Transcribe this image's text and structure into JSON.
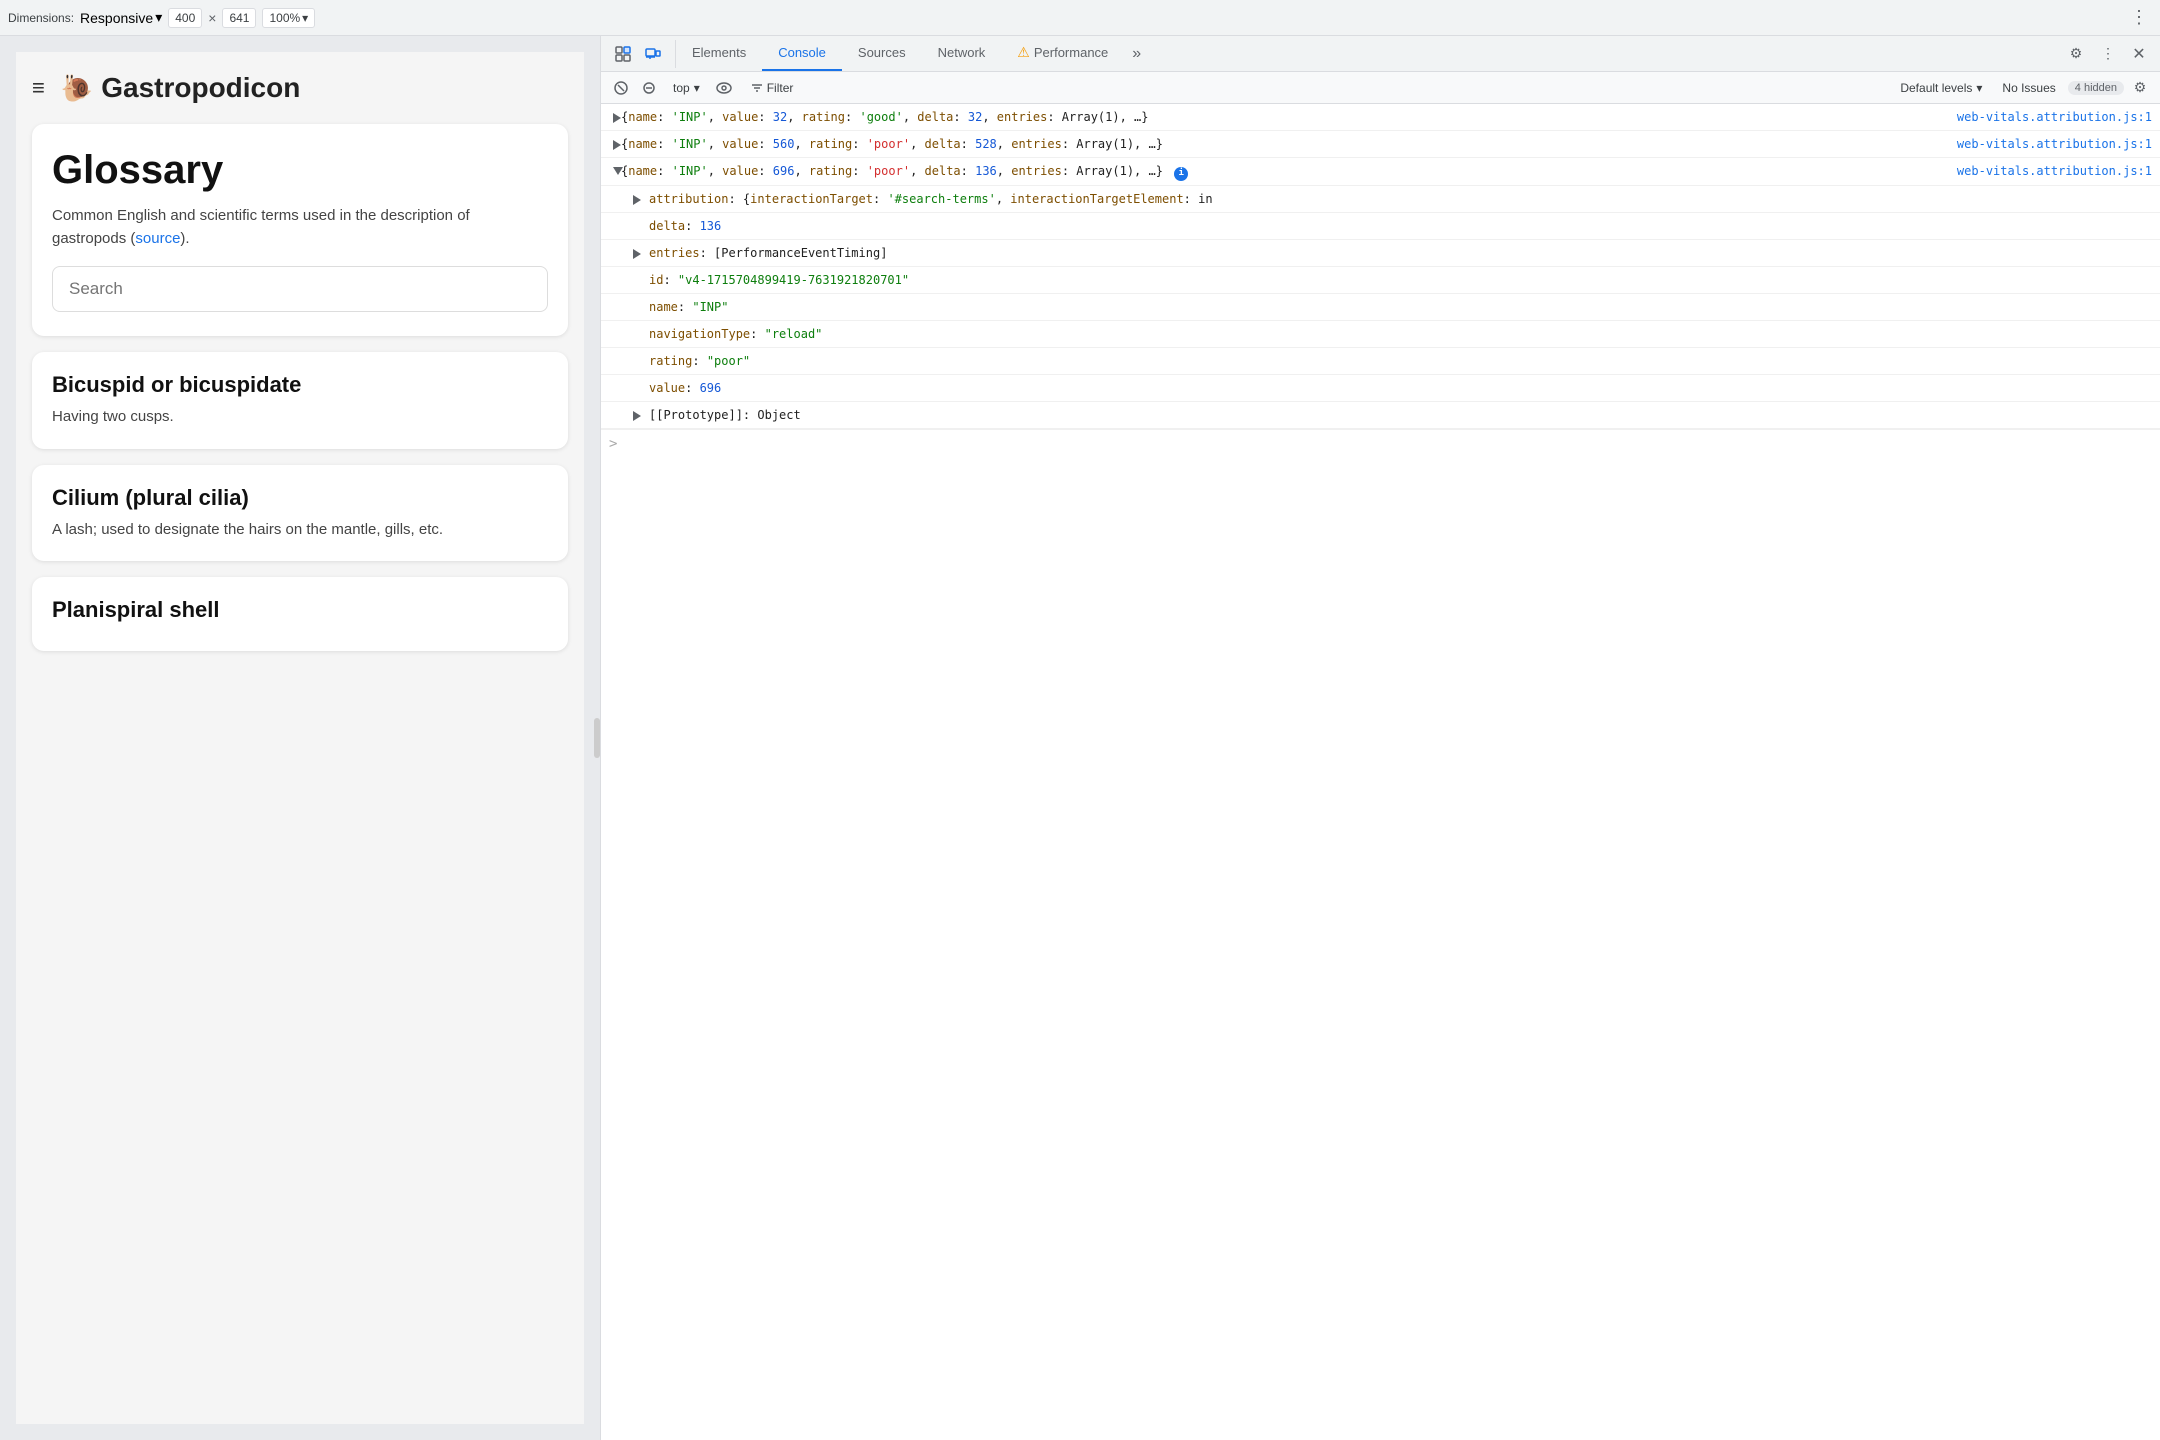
{
  "topToolbar": {
    "dimensionsLabel": "Dimensions:",
    "dimensionsType": "Responsive",
    "width": "400",
    "x": "×",
    "height": "641",
    "zoom": "100%",
    "zoomChevron": "▾",
    "typeChevron": "▾"
  },
  "webpage": {
    "hamburger": "≡",
    "logoEmoji": "🐌",
    "logoText": "Gastropodicon",
    "glossaryTitle": "Glossary",
    "glossaryDesc": "Common English and scientific terms used in the description of gastropods (",
    "sourceLink": "source",
    "glossaryDescEnd": ").",
    "searchPlaceholder": "Search",
    "terms": [
      {
        "title": "Bicuspid or bicuspidate",
        "desc": "Having two cusps."
      },
      {
        "title": "Cilium (plural cilia)",
        "desc": "A lash; used to designate the hairs on the mantle, gills, etc."
      },
      {
        "title": "Planispiral shell",
        "desc": ""
      }
    ]
  },
  "devtools": {
    "tabs": [
      {
        "id": "elements",
        "label": "Elements"
      },
      {
        "id": "console",
        "label": "Console"
      },
      {
        "id": "sources",
        "label": "Sources"
      },
      {
        "id": "network",
        "label": "Network"
      },
      {
        "id": "performance",
        "label": "Performance"
      }
    ],
    "activeTab": "console",
    "contextSelector": "top",
    "filterLabel": "Filter",
    "defaultLevels": "Default levels",
    "defaultLevelsChevron": "▾",
    "noIssues": "No Issues",
    "hiddenCount": "4 hidden",
    "consoleLines": [
      {
        "type": "collapsed",
        "link": "web-vitals.attribution.js:1",
        "text": "{name: 'INP', value: 32, rating: 'good', delta: 32, entries: Array(1), …}"
      },
      {
        "type": "collapsed",
        "link": "web-vitals.attribution.js:1",
        "text": "{name: 'INP', value: 560, rating: 'poor', delta: 528, entries: Array(1), …}"
      },
      {
        "type": "expanded",
        "link": "web-vitals.attribution.js:1",
        "text": "{name: 'INP', value: 696, rating: 'poor', delta: 136, entries: Array(1), …}",
        "hasInfo": true,
        "children": [
          {
            "type": "collapsed",
            "key": "attribution",
            "value": "{interactionTarget: '#search-terms', interactionTargetElement: in",
            "extra": ""
          },
          {
            "type": "leaf",
            "key": "delta",
            "value": "136"
          },
          {
            "type": "collapsed",
            "key": "entries",
            "value": "[PerformanceEventTiming]"
          },
          {
            "type": "leaf",
            "key": "id",
            "value": "\"v4-1715704899419-7631921820701\""
          },
          {
            "type": "leaf",
            "key": "name",
            "value": "\"INP\""
          },
          {
            "type": "leaf",
            "key": "navigationType",
            "value": "\"reload\""
          },
          {
            "type": "leaf",
            "key": "rating",
            "value": "\"poor\""
          },
          {
            "type": "leaf",
            "key": "value",
            "value": "696"
          },
          {
            "type": "collapsed",
            "key": "[[Prototype]]",
            "value": "Object"
          }
        ]
      }
    ],
    "promptChevron": ">"
  }
}
